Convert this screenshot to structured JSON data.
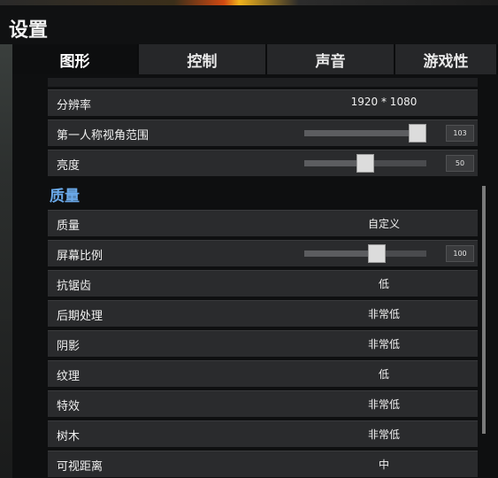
{
  "window": {
    "title": "设置"
  },
  "tabs": [
    {
      "label": "图形",
      "active": true
    },
    {
      "label": "控制",
      "active": false
    },
    {
      "label": "声音",
      "active": false
    },
    {
      "label": "游戏性",
      "active": false
    }
  ],
  "display": {
    "resolution": {
      "label": "分辨率",
      "value": "1920 * 1080"
    },
    "fov": {
      "label": "第一人称视角范围",
      "value": "103",
      "fraction": 0.92
    },
    "brightness": {
      "label": "亮度",
      "value": "50",
      "fraction": 0.5
    }
  },
  "quality_section": {
    "title": "质量",
    "preset": {
      "label": "质量",
      "value": "自定义"
    },
    "screen_scale": {
      "label": "屏幕比例",
      "value": "100",
      "fraction": 0.6
    },
    "items": [
      {
        "label": "抗锯齿",
        "value": "低"
      },
      {
        "label": "后期处理",
        "value": "非常低"
      },
      {
        "label": "阴影",
        "value": "非常低"
      },
      {
        "label": "纹理",
        "value": "低"
      },
      {
        "label": "特效",
        "value": "非常低"
      },
      {
        "label": "树木",
        "value": "非常低"
      },
      {
        "label": "可视距离",
        "value": "中"
      }
    ]
  },
  "colors": {
    "accent": "#6aa9e9",
    "row_bg": "#2a2b2d",
    "panel_bg": "#0e0f10"
  }
}
